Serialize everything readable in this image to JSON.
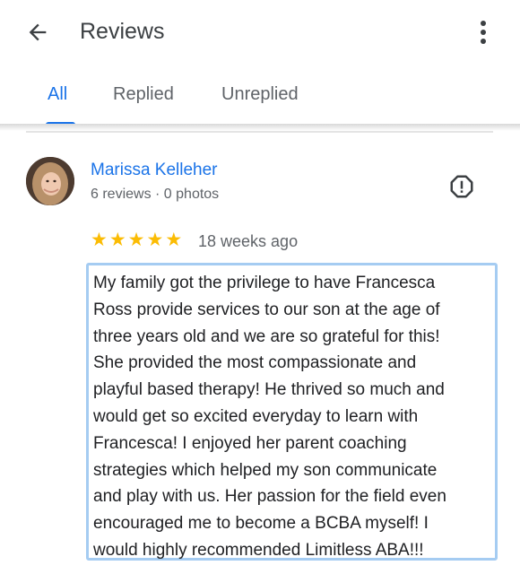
{
  "header": {
    "title": "Reviews",
    "back_icon": "arrow-back-icon",
    "more_icon": "more-vert-icon"
  },
  "tabs": [
    {
      "label": "All",
      "active": true
    },
    {
      "label": "Replied",
      "active": false
    },
    {
      "label": "Unreplied",
      "active": false
    }
  ],
  "colors": {
    "accent": "#1a73e8",
    "star": "#fbbc04",
    "focus_border": "#a5ccf2"
  },
  "review": {
    "reviewer_name": "Marissa Kelleher",
    "reviewer_meta": "6 reviews · 0 photos",
    "rating": 5,
    "rating_max": 5,
    "time": "18 weeks ago",
    "flag_icon": "report-flag-icon",
    "lines": [
      "My family got the privilege to have Francesca",
      "Ross provide services to our son at the age of",
      "three years old and we are so grateful for this!",
      "She provided the most compassionate and",
      "playful based therapy! He thrived so much and",
      "would get so excited everyday to learn with",
      "Francesca! I enjoyed her parent coaching",
      "strategies which helped my son communicate",
      "and play with us. Her passion for the field even",
      "encouraged me to become a BCBA myself! I",
      "would highly recommended Limitless ABA!!!"
    ]
  }
}
